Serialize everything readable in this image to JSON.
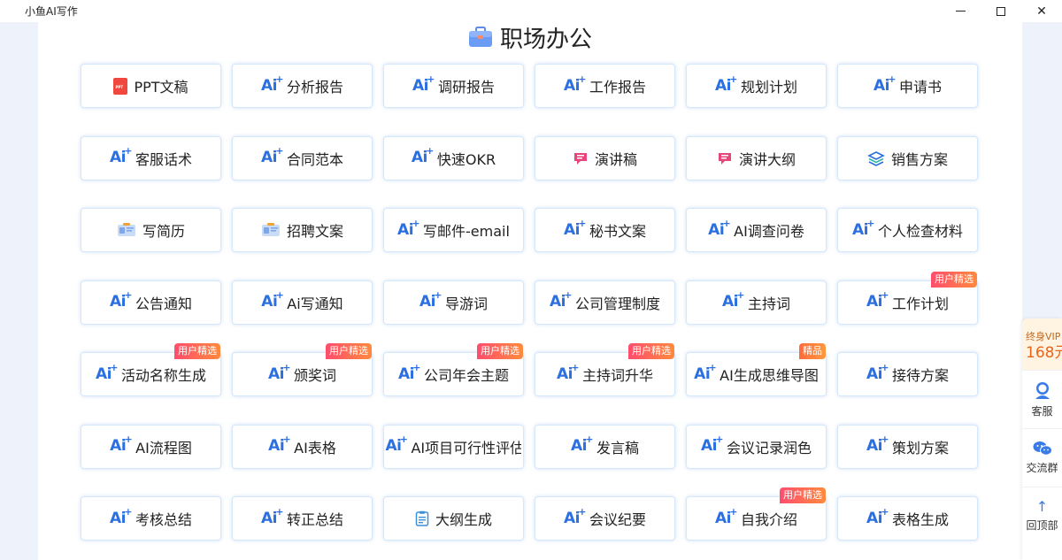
{
  "window": {
    "title": "小鱼AI写作"
  },
  "section": {
    "title": "职场办公"
  },
  "colors": {
    "accent": "#2b6fe0",
    "badge_start": "#ff4d6d",
    "badge_end": "#ff8a3d",
    "vip_text": "#e8641a"
  },
  "cards": [
    {
      "label": "PPT文稿",
      "icon": "ppt-icon",
      "badge": ""
    },
    {
      "label": "分析报告",
      "icon": "ai-icon",
      "badge": ""
    },
    {
      "label": "调研报告",
      "icon": "ai-icon",
      "badge": ""
    },
    {
      "label": "工作报告",
      "icon": "ai-icon",
      "badge": ""
    },
    {
      "label": "规划计划",
      "icon": "ai-icon",
      "badge": ""
    },
    {
      "label": "申请书",
      "icon": "ai-icon",
      "badge": ""
    },
    {
      "label": "客服话术",
      "icon": "ai-icon",
      "badge": ""
    },
    {
      "label": "合同范本",
      "icon": "ai-icon",
      "badge": ""
    },
    {
      "label": "快速OKR",
      "icon": "ai-icon",
      "badge": ""
    },
    {
      "label": "演讲稿",
      "icon": "speech-icon",
      "badge": ""
    },
    {
      "label": "演讲大纲",
      "icon": "speech-icon",
      "badge": ""
    },
    {
      "label": "销售方案",
      "icon": "layers-icon",
      "badge": ""
    },
    {
      "label": "写简历",
      "icon": "resume-icon",
      "badge": ""
    },
    {
      "label": "招聘文案",
      "icon": "resume-icon",
      "badge": ""
    },
    {
      "label": "写邮件-email",
      "icon": "ai-icon",
      "badge": ""
    },
    {
      "label": "秘书文案",
      "icon": "ai-icon",
      "badge": ""
    },
    {
      "label": "AI调查问卷",
      "icon": "ai-icon",
      "badge": ""
    },
    {
      "label": "个人检查材料",
      "icon": "ai-icon",
      "badge": ""
    },
    {
      "label": "公告通知",
      "icon": "ai-icon",
      "badge": ""
    },
    {
      "label": "Ai写通知",
      "icon": "ai-icon",
      "badge": ""
    },
    {
      "label": "导游词",
      "icon": "ai-icon",
      "badge": ""
    },
    {
      "label": "公司管理制度",
      "icon": "ai-icon",
      "badge": ""
    },
    {
      "label": "主持词",
      "icon": "ai-icon",
      "badge": ""
    },
    {
      "label": "工作计划",
      "icon": "ai-icon",
      "badge": "用户精选"
    },
    {
      "label": "活动名称生成",
      "icon": "ai-icon",
      "badge": "用户精选"
    },
    {
      "label": "颁奖词",
      "icon": "ai-icon",
      "badge": "用户精选"
    },
    {
      "label": "公司年会主题",
      "icon": "ai-icon",
      "badge": "用户精选"
    },
    {
      "label": "主持词升华",
      "icon": "ai-icon",
      "badge": "用户精选"
    },
    {
      "label": "AI生成思维导图",
      "icon": "ai-icon",
      "badge": "精品"
    },
    {
      "label": "接待方案",
      "icon": "ai-icon",
      "badge": ""
    },
    {
      "label": "AI流程图",
      "icon": "ai-icon",
      "badge": ""
    },
    {
      "label": "AI表格",
      "icon": "ai-icon",
      "badge": ""
    },
    {
      "label": "AI项目可行性评估",
      "icon": "ai-icon",
      "badge": ""
    },
    {
      "label": "发言稿",
      "icon": "ai-icon",
      "badge": ""
    },
    {
      "label": "会议记录润色",
      "icon": "ai-icon",
      "badge": ""
    },
    {
      "label": "策划方案",
      "icon": "ai-icon",
      "badge": ""
    },
    {
      "label": "考核总结",
      "icon": "ai-icon",
      "badge": ""
    },
    {
      "label": "转正总结",
      "icon": "ai-icon",
      "badge": ""
    },
    {
      "label": "大纲生成",
      "icon": "outline-icon",
      "badge": ""
    },
    {
      "label": "会议纪要",
      "icon": "ai-icon",
      "badge": ""
    },
    {
      "label": "自我介绍",
      "icon": "ai-icon",
      "badge": "用户精选"
    },
    {
      "label": "表格生成",
      "icon": "ai-icon",
      "badge": ""
    }
  ],
  "sidebar": {
    "vip_label": "终身VIP",
    "vip_price": "168元",
    "service_label": "客服",
    "group_label": "交流群",
    "top_label": "回顶部"
  }
}
